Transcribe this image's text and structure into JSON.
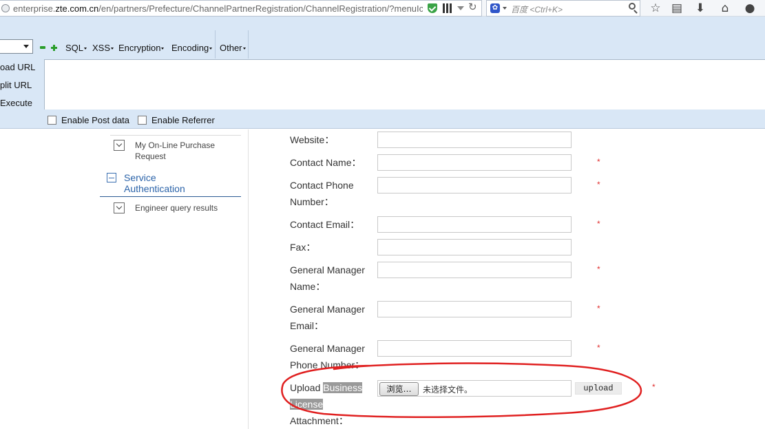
{
  "browser": {
    "url_prefix": "enterprise.",
    "url_domain": "zte.com.cn",
    "url_path": "/en/partners/Prefecture/ChannelPartnerRegistration/ChannelRegistration/?menuIc",
    "search_engine": "百度",
    "search_placeholder": "百度 <Ctrl+K>",
    "icons": [
      "globe-icon",
      "shield-check-icon",
      "qr-code-icon",
      "dropdown-icon",
      "reload-icon",
      "baidu-paw-icon",
      "search-icon",
      "bookmark-star-icon",
      "reading-list-icon",
      "download-icon",
      "home-icon",
      "chat-icon"
    ]
  },
  "hackbar": {
    "menus": [
      {
        "label": "SQL"
      },
      {
        "label": "XSS"
      },
      {
        "label": "Encryption"
      },
      {
        "label": "Encoding"
      },
      {
        "label": "Other"
      }
    ],
    "actions": {
      "load_url": "oad URL",
      "split_url": "plit URL",
      "execute": "Execute"
    },
    "enable_post": "Enable Post data",
    "enable_referrer": "Enable Referrer"
  },
  "sidebar": {
    "items": [
      {
        "label": "My On-Line Purchase Request"
      },
      {
        "label": "Service Authentication"
      },
      {
        "label": "Engineer query results"
      }
    ]
  },
  "form": {
    "fields": [
      {
        "label": "Website：",
        "required": false
      },
      {
        "label": "Contact Name：",
        "required": true
      },
      {
        "label": "Contact Phone Number：",
        "required": true
      },
      {
        "label": "Contact Email：",
        "required": true
      },
      {
        "label": "Fax：",
        "required": false
      },
      {
        "label": "General Manager Name：",
        "required": true
      },
      {
        "label": "General Manager Email：",
        "required": true
      },
      {
        "label": "General Manager Phone Number：",
        "required": true
      }
    ],
    "upload": {
      "label_plain": "Upload ",
      "label_highlight_1": "Business",
      "label_highlight_2": "License",
      "label_tail": "Attachment：",
      "browse_label": "浏览…",
      "no_file_text": "未选择文件。",
      "upload_button": "upload"
    },
    "required_mark": "*"
  },
  "colors": {
    "hackbar_bg": "#d9e7f6",
    "section_link": "#2b63a9",
    "required": "#e03030",
    "annotation": "#e02020"
  }
}
